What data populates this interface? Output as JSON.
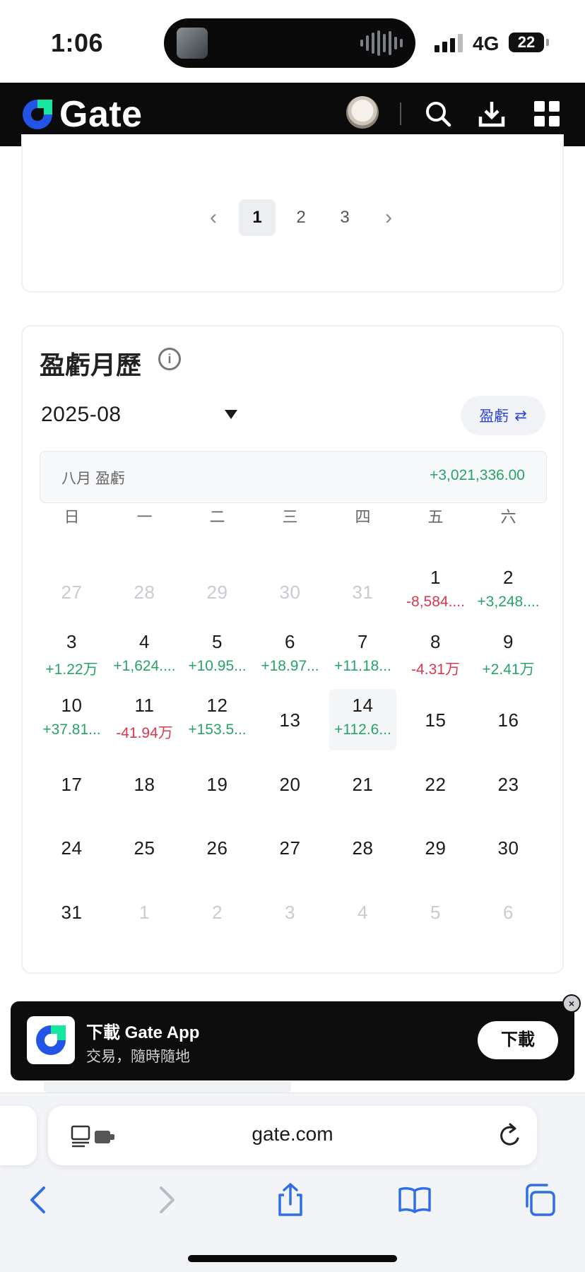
{
  "status_bar": {
    "time": "1:06",
    "network": "4G",
    "battery": "22"
  },
  "header": {
    "brand": "Gate"
  },
  "pagination": {
    "prev": "‹",
    "pages": [
      "1",
      "2",
      "3"
    ],
    "current": "1",
    "next": "›"
  },
  "calendar": {
    "title": "盈虧月歷",
    "info": "i",
    "month": "2025-08",
    "toggle_label": "盈虧",
    "toggle_icon": "⇄",
    "summary_label": "八月 盈虧",
    "summary_value": "+3,021,336.00",
    "weekdays": [
      "日",
      "一",
      "二",
      "三",
      "四",
      "五",
      "六"
    ],
    "cells": [
      {
        "day": "27",
        "muted": true
      },
      {
        "day": "28",
        "muted": true
      },
      {
        "day": "29",
        "muted": true
      },
      {
        "day": "30",
        "muted": true
      },
      {
        "day": "31",
        "muted": true
      },
      {
        "day": "1",
        "pnl": "-8,584....",
        "sign": "neg"
      },
      {
        "day": "2",
        "pnl": "+3,248....",
        "sign": "pos"
      },
      {
        "day": "3",
        "pnl": "+1.22万",
        "sign": "pos"
      },
      {
        "day": "4",
        "pnl": "+1,624....",
        "sign": "pos"
      },
      {
        "day": "5",
        "pnl": "+10.95...",
        "sign": "pos"
      },
      {
        "day": "6",
        "pnl": "+18.97...",
        "sign": "pos"
      },
      {
        "day": "7",
        "pnl": "+11.18...",
        "sign": "pos"
      },
      {
        "day": "8",
        "pnl": "-4.31万",
        "sign": "neg"
      },
      {
        "day": "9",
        "pnl": "+2.41万",
        "sign": "pos"
      },
      {
        "day": "10",
        "pnl": "+37.81...",
        "sign": "pos"
      },
      {
        "day": "11",
        "pnl": "-41.94万",
        "sign": "neg"
      },
      {
        "day": "12",
        "pnl": "+153.5...",
        "sign": "pos"
      },
      {
        "day": "13"
      },
      {
        "day": "14",
        "pnl": "+112.6...",
        "sign": "pos",
        "highlight": true
      },
      {
        "day": "15"
      },
      {
        "day": "16"
      },
      {
        "day": "17"
      },
      {
        "day": "18"
      },
      {
        "day": "19"
      },
      {
        "day": "20"
      },
      {
        "day": "21"
      },
      {
        "day": "22"
      },
      {
        "day": "23"
      },
      {
        "day": "24"
      },
      {
        "day": "25"
      },
      {
        "day": "26"
      },
      {
        "day": "27"
      },
      {
        "day": "28"
      },
      {
        "day": "29"
      },
      {
        "day": "30"
      },
      {
        "day": "31"
      },
      {
        "day": "1",
        "muted": true
      },
      {
        "day": "2",
        "muted": true
      },
      {
        "day": "3",
        "muted": true
      },
      {
        "day": "4",
        "muted": true
      },
      {
        "day": "5",
        "muted": true
      },
      {
        "day": "6",
        "muted": true
      }
    ]
  },
  "download_banner": {
    "title": "下載 Gate App",
    "subtitle": "交易，隨時隨地",
    "button": "下載",
    "close": "×"
  },
  "browser": {
    "url": "gate.com"
  },
  "colors": {
    "positive": "#27a36a",
    "negative": "#d9384f",
    "brand_blue": "#2354e6",
    "brand_green": "#17e6a1"
  }
}
